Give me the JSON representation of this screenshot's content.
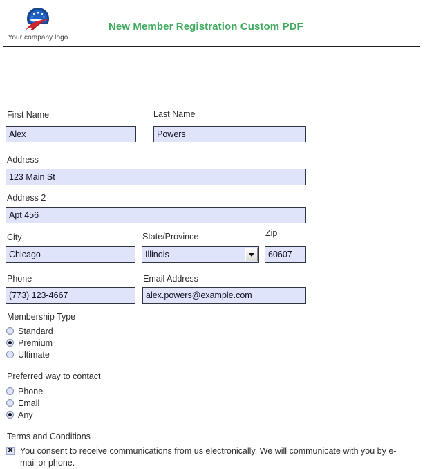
{
  "header": {
    "logo_caption": "Your company logo",
    "logo_icon": "company-logo-eagle-swoosh",
    "title": "New Member Registration Custom PDF",
    "title_color": "#3faa5e"
  },
  "theme": {
    "field_fill": "#dfe4fb",
    "field_border": "#2f3640",
    "text": "#2b2b2b",
    "rule": "#222222"
  },
  "form": {
    "first_name": {
      "label": "First Name",
      "value": "Alex",
      "placeholder": "First Name"
    },
    "last_name": {
      "label": "Last Name",
      "value": "Powers",
      "placeholder": "Last Name"
    },
    "address": {
      "label": "Address",
      "value": "123 Main St",
      "placeholder": "Address"
    },
    "address2": {
      "label": "Address 2",
      "value": "Apt 456",
      "placeholder": "Address 2"
    },
    "city": {
      "label": "City",
      "value": "Chicago",
      "placeholder": "City"
    },
    "state": {
      "label": "State/Province",
      "value": "Illinois",
      "placeholder": "State/Province",
      "caret_icon": "chevron-down-icon"
    },
    "zip": {
      "label": "Zip",
      "value": "60607",
      "placeholder": "Zip"
    },
    "phone": {
      "label": "Phone",
      "value": "(773) 123-4667",
      "placeholder": "Phone"
    },
    "email": {
      "label": "Email Address",
      "value": "alex.powers@example.com",
      "placeholder": "Email Address"
    },
    "membership": {
      "label": "Membership Type",
      "options": [
        {
          "label": "Standard",
          "selected": false
        },
        {
          "label": "Premium",
          "selected": true
        },
        {
          "label": "Ultimate",
          "selected": false
        }
      ]
    },
    "contact_pref": {
      "label": "Preferred way to contact",
      "options": [
        {
          "label": "Phone",
          "selected": false
        },
        {
          "label": "Email",
          "selected": false
        },
        {
          "label": "Any",
          "selected": true
        }
      ]
    },
    "terms": {
      "label": "Terms and Conditions",
      "checkbox_mark": "✕",
      "checked": true,
      "text": "You consent to receive communications from us electronically. We will communicate with you by e-mail or phone."
    }
  }
}
